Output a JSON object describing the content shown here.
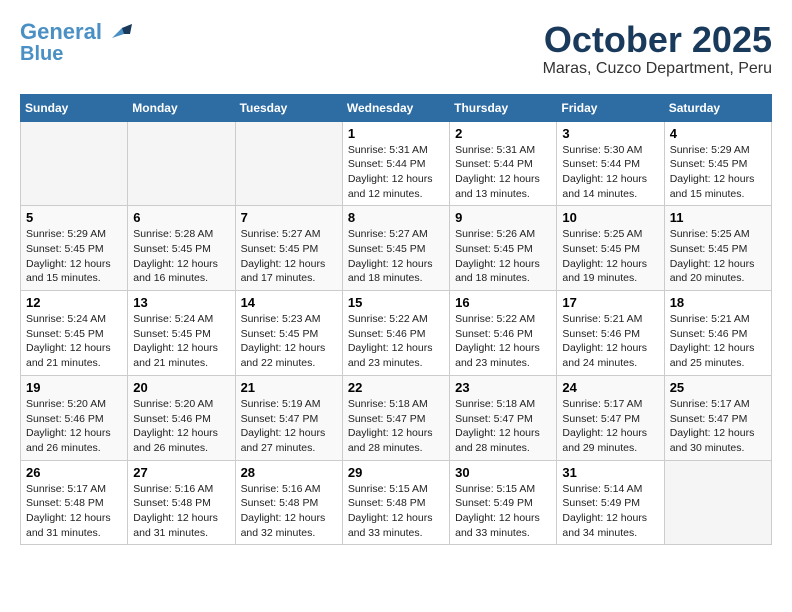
{
  "header": {
    "logo_line1": "General",
    "logo_line2": "Blue",
    "month": "October 2025",
    "location": "Maras, Cuzco Department, Peru"
  },
  "weekdays": [
    "Sunday",
    "Monday",
    "Tuesday",
    "Wednesday",
    "Thursday",
    "Friday",
    "Saturday"
  ],
  "weeks": [
    [
      {
        "day": "",
        "info": ""
      },
      {
        "day": "",
        "info": ""
      },
      {
        "day": "",
        "info": ""
      },
      {
        "day": "1",
        "info": "Sunrise: 5:31 AM\nSunset: 5:44 PM\nDaylight: 12 hours\nand 12 minutes."
      },
      {
        "day": "2",
        "info": "Sunrise: 5:31 AM\nSunset: 5:44 PM\nDaylight: 12 hours\nand 13 minutes."
      },
      {
        "day": "3",
        "info": "Sunrise: 5:30 AM\nSunset: 5:44 PM\nDaylight: 12 hours\nand 14 minutes."
      },
      {
        "day": "4",
        "info": "Sunrise: 5:29 AM\nSunset: 5:45 PM\nDaylight: 12 hours\nand 15 minutes."
      }
    ],
    [
      {
        "day": "5",
        "info": "Sunrise: 5:29 AM\nSunset: 5:45 PM\nDaylight: 12 hours\nand 15 minutes."
      },
      {
        "day": "6",
        "info": "Sunrise: 5:28 AM\nSunset: 5:45 PM\nDaylight: 12 hours\nand 16 minutes."
      },
      {
        "day": "7",
        "info": "Sunrise: 5:27 AM\nSunset: 5:45 PM\nDaylight: 12 hours\nand 17 minutes."
      },
      {
        "day": "8",
        "info": "Sunrise: 5:27 AM\nSunset: 5:45 PM\nDaylight: 12 hours\nand 18 minutes."
      },
      {
        "day": "9",
        "info": "Sunrise: 5:26 AM\nSunset: 5:45 PM\nDaylight: 12 hours\nand 18 minutes."
      },
      {
        "day": "10",
        "info": "Sunrise: 5:25 AM\nSunset: 5:45 PM\nDaylight: 12 hours\nand 19 minutes."
      },
      {
        "day": "11",
        "info": "Sunrise: 5:25 AM\nSunset: 5:45 PM\nDaylight: 12 hours\nand 20 minutes."
      }
    ],
    [
      {
        "day": "12",
        "info": "Sunrise: 5:24 AM\nSunset: 5:45 PM\nDaylight: 12 hours\nand 21 minutes."
      },
      {
        "day": "13",
        "info": "Sunrise: 5:24 AM\nSunset: 5:45 PM\nDaylight: 12 hours\nand 21 minutes."
      },
      {
        "day": "14",
        "info": "Sunrise: 5:23 AM\nSunset: 5:45 PM\nDaylight: 12 hours\nand 22 minutes."
      },
      {
        "day": "15",
        "info": "Sunrise: 5:22 AM\nSunset: 5:46 PM\nDaylight: 12 hours\nand 23 minutes."
      },
      {
        "day": "16",
        "info": "Sunrise: 5:22 AM\nSunset: 5:46 PM\nDaylight: 12 hours\nand 23 minutes."
      },
      {
        "day": "17",
        "info": "Sunrise: 5:21 AM\nSunset: 5:46 PM\nDaylight: 12 hours\nand 24 minutes."
      },
      {
        "day": "18",
        "info": "Sunrise: 5:21 AM\nSunset: 5:46 PM\nDaylight: 12 hours\nand 25 minutes."
      }
    ],
    [
      {
        "day": "19",
        "info": "Sunrise: 5:20 AM\nSunset: 5:46 PM\nDaylight: 12 hours\nand 26 minutes."
      },
      {
        "day": "20",
        "info": "Sunrise: 5:20 AM\nSunset: 5:46 PM\nDaylight: 12 hours\nand 26 minutes."
      },
      {
        "day": "21",
        "info": "Sunrise: 5:19 AM\nSunset: 5:47 PM\nDaylight: 12 hours\nand 27 minutes."
      },
      {
        "day": "22",
        "info": "Sunrise: 5:18 AM\nSunset: 5:47 PM\nDaylight: 12 hours\nand 28 minutes."
      },
      {
        "day": "23",
        "info": "Sunrise: 5:18 AM\nSunset: 5:47 PM\nDaylight: 12 hours\nand 28 minutes."
      },
      {
        "day": "24",
        "info": "Sunrise: 5:17 AM\nSunset: 5:47 PM\nDaylight: 12 hours\nand 29 minutes."
      },
      {
        "day": "25",
        "info": "Sunrise: 5:17 AM\nSunset: 5:47 PM\nDaylight: 12 hours\nand 30 minutes."
      }
    ],
    [
      {
        "day": "26",
        "info": "Sunrise: 5:17 AM\nSunset: 5:48 PM\nDaylight: 12 hours\nand 31 minutes."
      },
      {
        "day": "27",
        "info": "Sunrise: 5:16 AM\nSunset: 5:48 PM\nDaylight: 12 hours\nand 31 minutes."
      },
      {
        "day": "28",
        "info": "Sunrise: 5:16 AM\nSunset: 5:48 PM\nDaylight: 12 hours\nand 32 minutes."
      },
      {
        "day": "29",
        "info": "Sunrise: 5:15 AM\nSunset: 5:48 PM\nDaylight: 12 hours\nand 33 minutes."
      },
      {
        "day": "30",
        "info": "Sunrise: 5:15 AM\nSunset: 5:49 PM\nDaylight: 12 hours\nand 33 minutes."
      },
      {
        "day": "31",
        "info": "Sunrise: 5:14 AM\nSunset: 5:49 PM\nDaylight: 12 hours\nand 34 minutes."
      },
      {
        "day": "",
        "info": ""
      }
    ]
  ]
}
